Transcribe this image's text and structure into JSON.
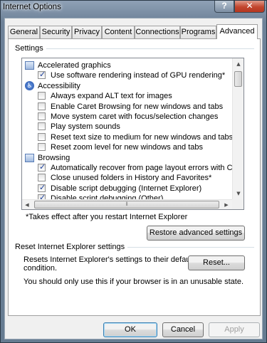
{
  "window": {
    "title": "Internet Options",
    "help_glyph": "?",
    "close_glyph": "✕"
  },
  "tabs": [
    "General",
    "Security",
    "Privacy",
    "Content",
    "Connections",
    "Programs",
    "Advanced"
  ],
  "active_tab": "Advanced",
  "settings": {
    "group_label": "Settings",
    "rows": [
      {
        "type": "category",
        "icon": "monitor-icon",
        "label": "Accelerated graphics"
      },
      {
        "type": "checkbox",
        "checked": true,
        "label": "Use software rendering instead of GPU rendering*"
      },
      {
        "type": "category",
        "icon": "accessibility-icon",
        "label": "Accessibility"
      },
      {
        "type": "checkbox",
        "checked": false,
        "label": "Always expand ALT text for images"
      },
      {
        "type": "checkbox",
        "checked": false,
        "label": "Enable Caret Browsing for new windows and tabs"
      },
      {
        "type": "checkbox",
        "checked": false,
        "label": "Move system caret with focus/selection changes"
      },
      {
        "type": "checkbox",
        "checked": false,
        "label": "Play system sounds"
      },
      {
        "type": "checkbox",
        "checked": false,
        "label": "Reset text size to medium for new windows and tabs"
      },
      {
        "type": "checkbox",
        "checked": false,
        "label": "Reset zoom level for new windows and tabs"
      },
      {
        "type": "category",
        "icon": "browsing-icon",
        "label": "Browsing"
      },
      {
        "type": "checkbox",
        "checked": true,
        "label": "Automatically recover from page layout errors with Compa"
      },
      {
        "type": "checkbox",
        "checked": false,
        "label": "Close unused folders in History and Favorites*"
      },
      {
        "type": "checkbox",
        "checked": true,
        "label": "Disable script debugging (Internet Explorer)"
      },
      {
        "type": "checkbox",
        "checked": true,
        "label": "Disable script debugging (Other)"
      }
    ],
    "restart_note": "*Takes effect after you restart Internet Explorer",
    "restore_button": "Restore advanced settings"
  },
  "reset": {
    "group_label": "Reset Internet Explorer settings",
    "description_line1": "Resets Internet Explorer's settings to their default",
    "description_line2": "condition.",
    "reset_button": "Reset...",
    "warning": "You should only use this if your browser is in an unusable state."
  },
  "footer": {
    "ok": "OK",
    "cancel": "Cancel",
    "apply": "Apply"
  }
}
